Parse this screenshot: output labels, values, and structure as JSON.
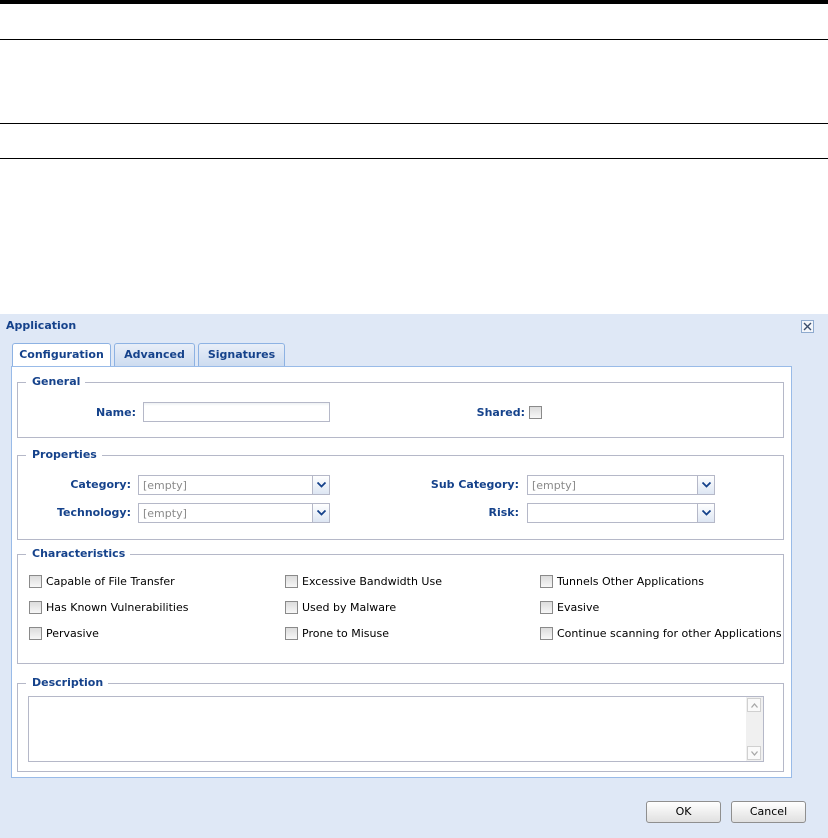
{
  "dialog": {
    "title": "Application",
    "close_icon": "close-icon"
  },
  "tabs": [
    {
      "label": "Configuration",
      "active": true
    },
    {
      "label": "Advanced",
      "active": false
    },
    {
      "label": "Signatures",
      "active": false
    }
  ],
  "general": {
    "legend": "General",
    "name_label": "Name:",
    "name_value": "",
    "shared_label": "Shared:",
    "shared_checked": false
  },
  "properties": {
    "legend": "Properties",
    "category_label": "Category:",
    "category_value": "[empty]",
    "subcategory_label": "Sub Category:",
    "subcategory_value": "[empty]",
    "technology_label": "Technology:",
    "technology_value": "[empty]",
    "risk_label": "Risk:",
    "risk_value": ""
  },
  "characteristics": {
    "legend": "Characteristics",
    "items": [
      {
        "label": "Capable of File Transfer",
        "checked": false
      },
      {
        "label": "Excessive Bandwidth Use",
        "checked": false
      },
      {
        "label": "Tunnels Other Applications",
        "checked": false
      },
      {
        "label": "Has Known Vulnerabilities",
        "checked": false
      },
      {
        "label": "Used by Malware",
        "checked": false
      },
      {
        "label": "Evasive",
        "checked": false
      },
      {
        "label": "Pervasive",
        "checked": false
      },
      {
        "label": "Prone to Misuse",
        "checked": false
      },
      {
        "label": "Continue scanning for other Applications",
        "checked": false
      }
    ]
  },
  "description": {
    "legend": "Description",
    "value": ""
  },
  "buttons": {
    "ok": "OK",
    "cancel": "Cancel"
  },
  "colors": {
    "dialog_bg": "#dfe8f6",
    "label_blue": "#15428b"
  }
}
